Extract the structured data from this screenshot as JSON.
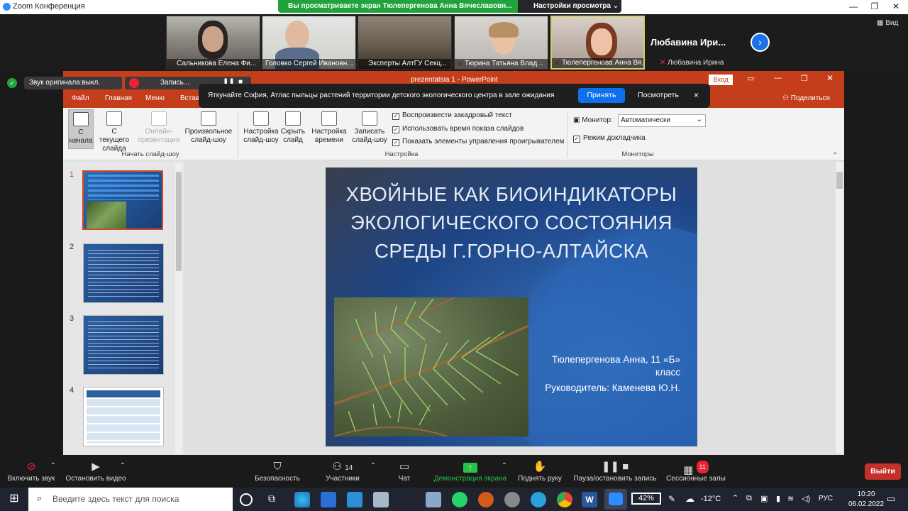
{
  "zoom": {
    "window_title": "Zoom Конференция",
    "share_banner": "Вы просматриваете экран Тюлепергенова Анна Вячеславовн...",
    "view_settings": "Настройки просмотра",
    "view_btn": "Вид",
    "audio_chip": "Звук оригинала:выкл.",
    "record_chip": "Запись...",
    "participants": [
      {
        "name": "Сальникова Елена Фи...",
        "muted": true
      },
      {
        "name": "Головко Сергей Ивановн...",
        "muted": false
      },
      {
        "name": "Эксперты АлтГУ Секц...",
        "muted": true
      },
      {
        "name": "Тюрина Татьяна Влад...",
        "muted": true
      },
      {
        "name": "Тюлепергенова Анна Вя...",
        "muted": true
      }
    ],
    "lubavina_big": "Любавина Ири...",
    "lubavina_small": "Любавина Ирина",
    "notification": {
      "message": "Яткунайте София, Атлас пыльцы растений территории детского экологического центра в зале ожидания",
      "accept": "Принять",
      "view": "Посмотреть",
      "close": "×"
    },
    "toolbar": {
      "audio": "Включить звук",
      "video": "Остановить видео",
      "security": "Безопасность",
      "participants": "Участники",
      "participants_count": "14",
      "chat": "Чат",
      "share": "Демонстрация экрана",
      "raise_hand": "Поднять руку",
      "pause_record": "Пауза/остановить запись",
      "breakout": "Сессионные залы",
      "breakout_badge": "11",
      "exit": "Выйти"
    }
  },
  "ppt": {
    "title": "prezentatsia 1  -  PowerPoint",
    "signin": "Вход",
    "tabs": [
      "Файл",
      "Главная",
      "Меню",
      "Вставка"
    ],
    "share": "Поделиться",
    "ribbon": {
      "from_start": "С начала",
      "from_current": "С текущего слайда",
      "online": "Онлайн-презентация",
      "custom": "Произвольное слайд-шоу",
      "group_start": "Начать слайд-шоу",
      "setup": "Настройка слайд-шоу",
      "hide": "Скрыть слайд",
      "timing": "Настройка времени",
      "record": "Записать слайд-шоу",
      "chk_narration": "Воспроизвести закадровый текст",
      "chk_timings": "Использовать время показа слайдов",
      "chk_controls": "Показать элементы управления проигрывателем",
      "group_setup": "Настройка",
      "monitor_label": "Монитор:",
      "monitor_value": "Автоматически",
      "presenter_view": "Режим докладчика",
      "group_monitors": "Мониторы"
    },
    "slide_numbers": [
      "1",
      "2",
      "3",
      "4"
    ],
    "slide": {
      "title": "ХВОЙНЫЕ КАК БИОИНДИКАТОРЫ ЭКОЛОГИЧЕСКОГО СОСТОЯНИЯ СРЕДЫ Г.ГОРНО-АЛТАЙСКА",
      "author": "Тюлепергенова Анна, 11 «Б» класс",
      "leader": "Руководитель: Каменева Ю.Н."
    }
  },
  "taskbar": {
    "search_placeholder": "Введите здесь текст для поиска",
    "battery": "42%",
    "temperature": "-12°C",
    "language": "РУС",
    "time": "10:20",
    "date": "06.02.2022"
  },
  "colors": {
    "ppt_accent": "#c43e1c",
    "zoom_share_green": "#21a33b",
    "zoom_blue": "#0e71eb",
    "exit_red": "#c4312b"
  }
}
